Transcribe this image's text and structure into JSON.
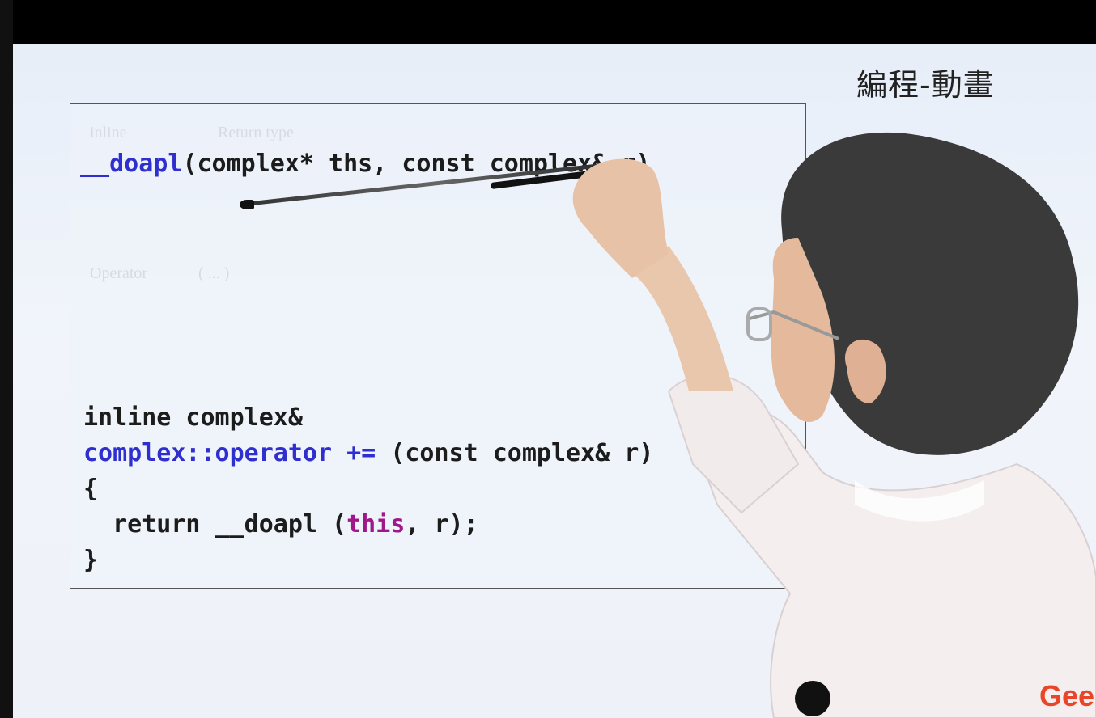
{
  "header": {
    "title": "編程-動畫"
  },
  "slide": {
    "ghost_labels": [
      "inline",
      "Return type",
      "Operator",
      "( ... )"
    ],
    "code_lines": {
      "line1_fn": "__doapl",
      "line1_rest": "(complex* ths, const complex& r)",
      "line2": "inline complex&",
      "line3_kw": "complex::operator +=",
      "line3_rest": " (const complex& r)",
      "line4": "{",
      "line5_a": "  return __doapl (",
      "line5_this": "this",
      "line5_b": ", r);",
      "line6": "}"
    }
  },
  "watermark": {
    "text": "Gee"
  },
  "colors": {
    "keyword": "#2f2fcf",
    "this_keyword": "#a0178b",
    "watermark": "#e8452b"
  }
}
